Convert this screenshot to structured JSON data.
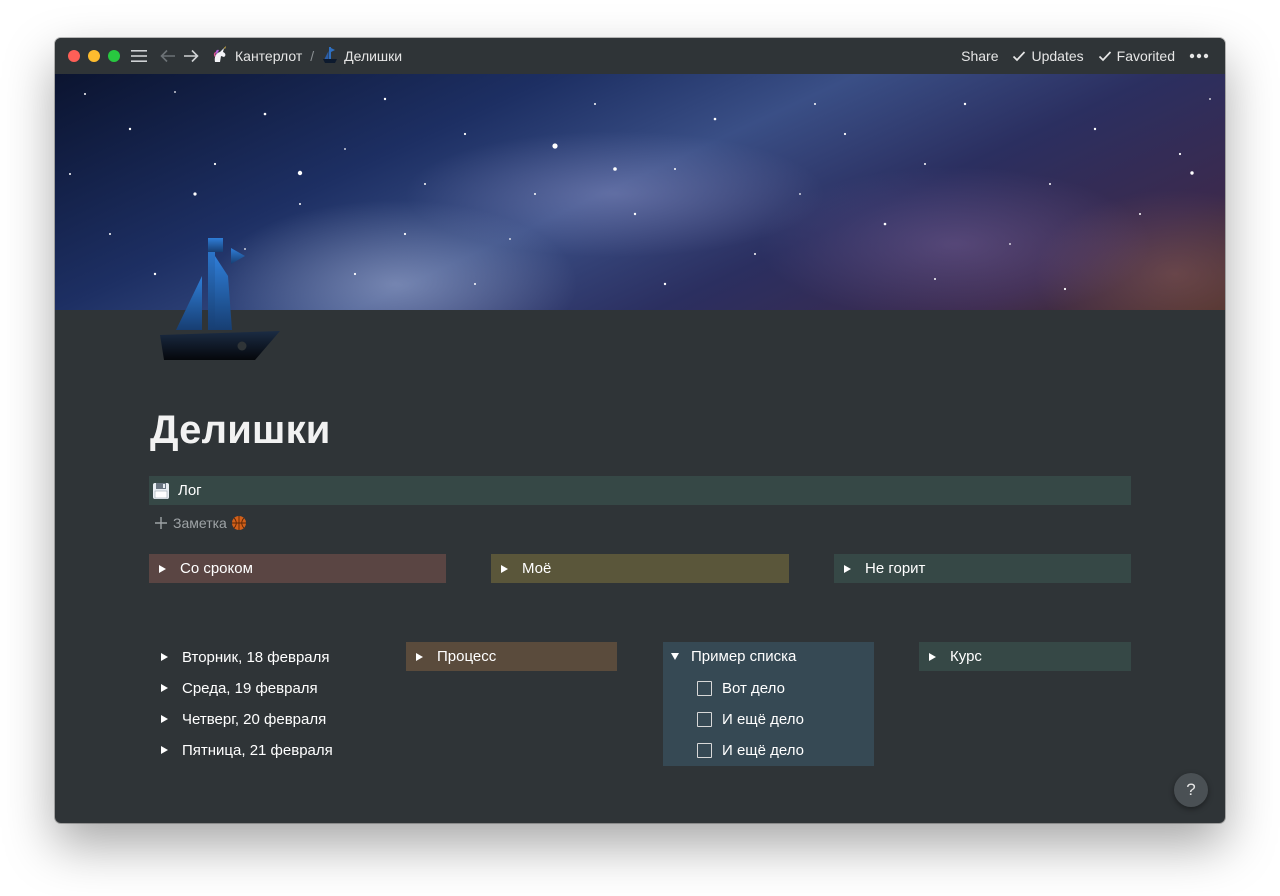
{
  "window": {
    "bg": "#2f3437"
  },
  "titlebar": {
    "breadcrumbs": [
      {
        "label": "Кантерлот",
        "icon": "unicorn-icon"
      },
      {
        "label": "Делишки",
        "icon": "ship-icon"
      }
    ],
    "separator": "/",
    "actions": {
      "share": "Share",
      "updates": "Updates",
      "favorited": "Favorited"
    }
  },
  "page": {
    "title": "Делишки",
    "log": {
      "label": "Лог",
      "icon": "floppy-disk-icon",
      "color": "#364846"
    },
    "add_note": {
      "label": "Заметка",
      "icon": "basketball-icon"
    },
    "top_toggles": [
      {
        "label": "Со сроком",
        "color": "#5a4543"
      },
      {
        "label": "Моё",
        "color": "#5a563a"
      },
      {
        "label": "Не горит",
        "color": "#364846"
      }
    ],
    "days": [
      "Вторник, 18 февраля",
      "Среда, 19 февраля",
      "Четверг, 20 февраля",
      "Пятница, 21 февраля"
    ],
    "process": {
      "label": "Процесс",
      "color": "#5a4b3c"
    },
    "example_list": {
      "label": "Пример списка",
      "color": "#364954",
      "items": [
        "Вот дело",
        "И ещё дело",
        "И ещё дело"
      ]
    },
    "course": {
      "label": "Курс",
      "color": "#364846"
    }
  },
  "help": {
    "label": "?"
  }
}
